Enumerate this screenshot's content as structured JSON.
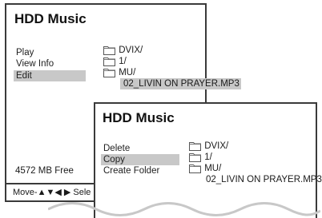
{
  "screen1": {
    "title": "HDD Music",
    "menu": [
      {
        "label": "Play",
        "selected": false
      },
      {
        "label": "View Info",
        "selected": false
      },
      {
        "label": "Edit",
        "selected": true
      }
    ],
    "files": [
      {
        "name": "DVIX/",
        "icon": "folder-icon"
      },
      {
        "name": "1/",
        "icon": "folder-icon"
      },
      {
        "name": "MU/",
        "icon": "folder-icon"
      },
      {
        "name": "02_LIVIN ON PRAYER.MP3",
        "icon": "",
        "selected": true
      }
    ],
    "free_space": "4572 MB Free",
    "help": {
      "move_label": "Move-",
      "arrows": "▲▼◀ ▶",
      "rest": " Sele"
    }
  },
  "screen2": {
    "title": "HDD Music",
    "menu": [
      {
        "label": "Delete",
        "selected": false
      },
      {
        "label": "Copy",
        "selected": true
      },
      {
        "label": "Create Folder",
        "selected": false
      }
    ],
    "files": [
      {
        "name": "DVIX/",
        "icon": "folder-icon"
      },
      {
        "name": "1/",
        "icon": "folder-icon"
      },
      {
        "name": "MU/",
        "icon": "folder-icon"
      },
      {
        "name": "02_LIVIN ON PRAYER.MP3",
        "icon": ""
      }
    ]
  }
}
